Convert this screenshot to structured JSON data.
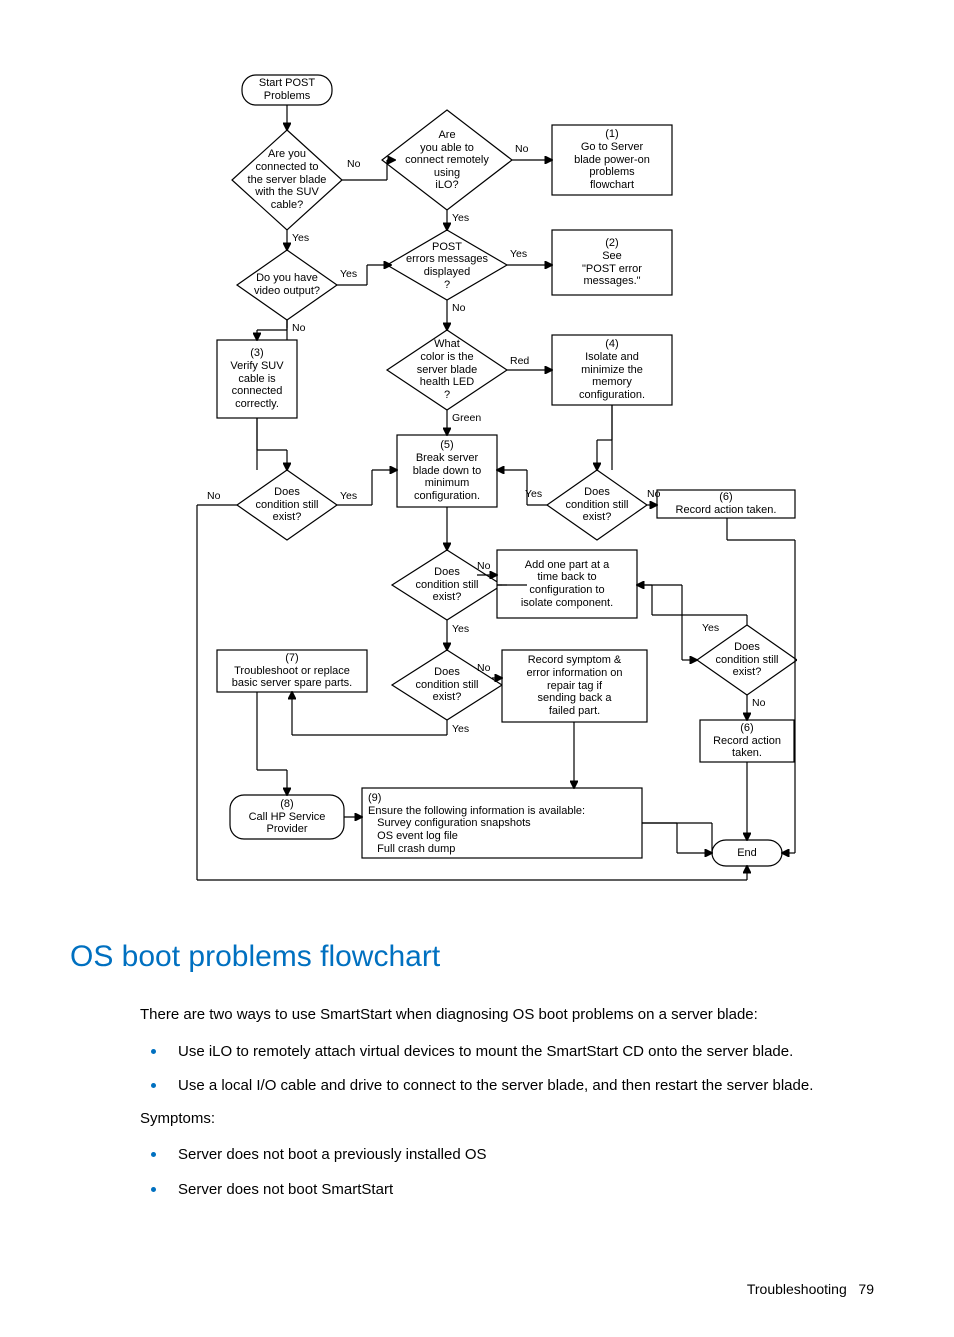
{
  "flowchart": {
    "nodes": {
      "start": "Start POST\nProblems",
      "q_suv": "Are you\nconnected to\nthe server blade\nwith the SUV\ncable?",
      "q_video": "Do you have\nvideo output?",
      "n3": "(3)\nVerify SUV\ncable is\nconnected\ncorrectly.",
      "q_still_left": "Does\ncondition still\nexist?",
      "q_ilo": "Are\nyou able to\nconnect remotely\nusing\niLO?",
      "n1": "(1)\nGo to Server\nblade power-on\nproblems\nflowchart",
      "q_post": "POST\nerrors messages\ndisplayed\n?",
      "n2": "(2)\nSee\n\"POST error\nmessages.\"",
      "q_led": "What\ncolor is the\nserver blade\nhealth LED\n?",
      "n4": "(4)\nIsolate and\nminimize the\nmemory\nconfiguration.",
      "n5": "(5)\nBreak server\nblade down to\nminimum\nconfiguration.",
      "q_still_4": "Does\ncondition still\nexist?",
      "n6": "(6)\nRecord action taken.",
      "q_still_mid": "Does\ncondition still\nexist?",
      "addback": "Add one part at a\ntime back to\nconfiguration to\nisolate component.",
      "q_still_add": "Does\ncondition still\nexist?",
      "n6b": "(6)\nRecord action\ntaken.",
      "q_still_7": "Does\ncondition still\nexist?",
      "record_sym": "Record symptom &\nerror information on\nrepair tag if\nsending back a\nfailed part.",
      "n7": "(7)\nTroubleshoot or replace\nbasic server spare parts.",
      "n8": "(8)\nCall HP Service\nProvider",
      "n9": "(9)\nEnsure the following information is available:\n   Survey configuration snapshots\n   OS event log file\n   Full crash dump",
      "end": "End"
    },
    "edge_labels": {
      "no": "No",
      "yes": "Yes",
      "red": "Red",
      "green": "Green"
    }
  },
  "heading": "OS boot problems flowchart",
  "body": {
    "intro": "There are two ways to use SmartStart when diagnosing OS boot problems on a server blade:",
    "methods": [
      "Use iLO to remotely attach virtual devices to mount the SmartStart CD onto the server blade.",
      "Use a local I/O cable and drive to connect to the server blade, and then restart the server blade."
    ],
    "symptoms_label": "Symptoms:",
    "symptoms": [
      "Server does not boot a previously installed OS",
      "Server does not boot SmartStart"
    ]
  },
  "footer": {
    "section": "Troubleshooting",
    "page": "79"
  }
}
